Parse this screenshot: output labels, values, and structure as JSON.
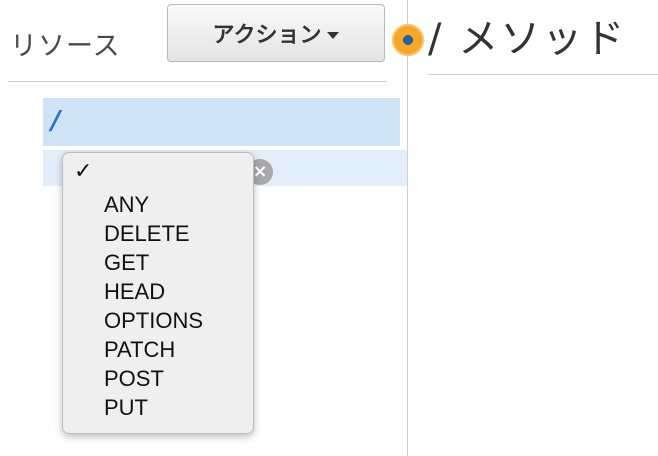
{
  "resources_panel": {
    "title": "リソース",
    "actions_button": {
      "label": "アクション"
    }
  },
  "methods_panel": {
    "title": "/ メソッド"
  },
  "resource_tree": {
    "root_path": "/",
    "clear_icon": "×"
  },
  "method_dropdown": {
    "selected_marker": "✓",
    "options": [
      "ANY",
      "DELETE",
      "GET",
      "HEAD",
      "OPTIONS",
      "PATCH",
      "POST",
      "PUT"
    ]
  },
  "colors": {
    "selected_row": "#cfe3f7",
    "method_row": "#e2eefa",
    "path_text": "#2a72c2",
    "marker": "#f5a623"
  }
}
